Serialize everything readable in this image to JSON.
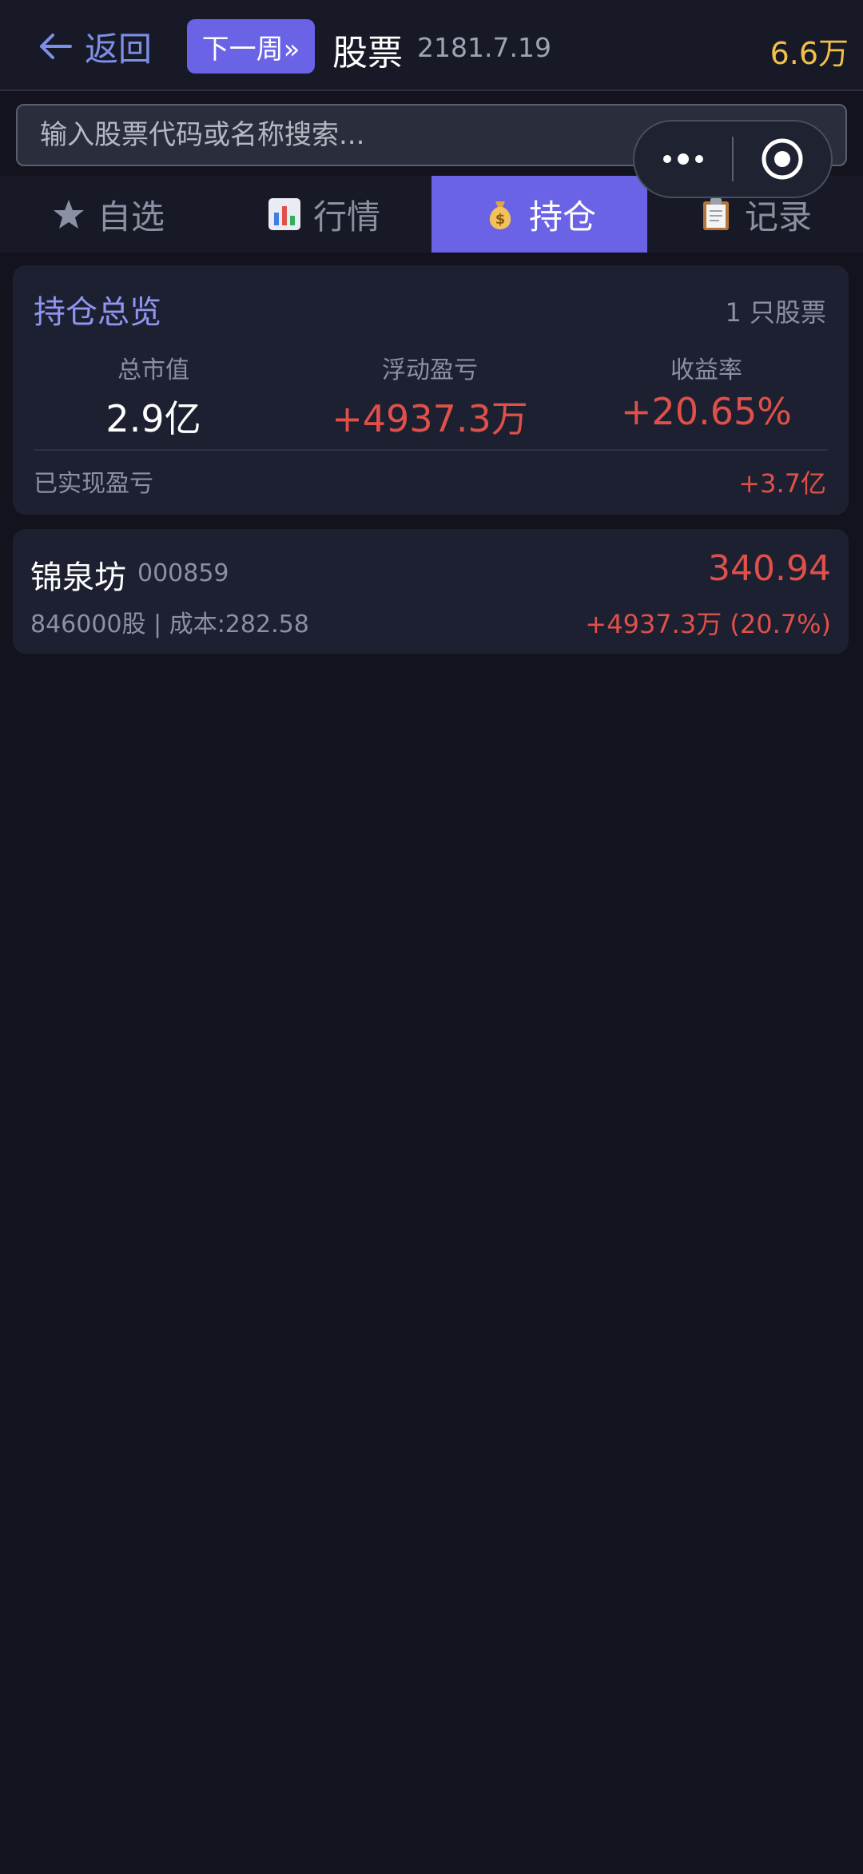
{
  "header": {
    "back_label": "返回",
    "next_week_label": "下一周»",
    "title": "股票",
    "date": "2181.7.19",
    "cash": "6.6万"
  },
  "search": {
    "placeholder": "输入股票代码或名称搜索..."
  },
  "tabs": [
    {
      "label": "自选",
      "icon": "star-icon"
    },
    {
      "label": "行情",
      "icon": "bar-chart-icon"
    },
    {
      "label": "持仓",
      "icon": "money-bag-icon",
      "active": true
    },
    {
      "label": "记录",
      "icon": "clipboard-icon"
    }
  ],
  "overview": {
    "title": "持仓总览",
    "count": "1 只股票",
    "metrics": [
      {
        "label": "总市值",
        "value": "2.9亿"
      },
      {
        "label": "浮动盈亏",
        "value": "+4937.3万"
      },
      {
        "label": "收益率",
        "value": "+20.65%"
      }
    ],
    "realized_label": "已实现盈亏",
    "realized_value": "+3.7亿"
  },
  "holdings": [
    {
      "name": "锦泉坊",
      "code": "000859",
      "price": "340.94",
      "shares_cost": "846000股 | 成本:282.58",
      "pnl": "+4937.3万 (20.7%)"
    }
  ],
  "colors": {
    "accent": "#6a63e6",
    "profit_red": "#e0504a",
    "cash_gold": "#f2bf4a",
    "background": "#12131c"
  }
}
